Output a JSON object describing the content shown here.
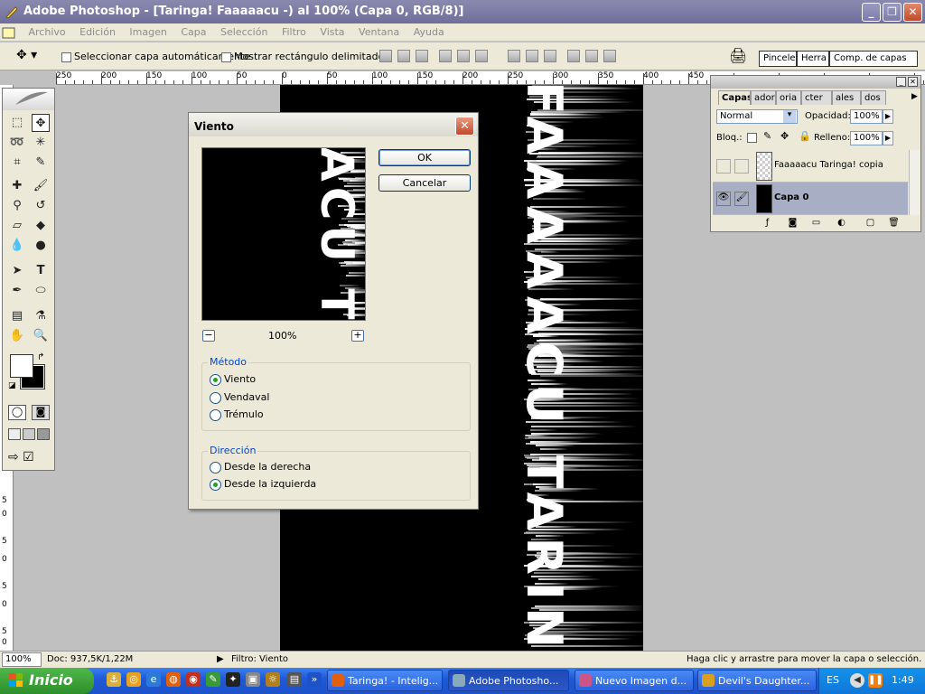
{
  "window": {
    "title": "Adobe Photoshop - [Taringa! Faaaaacu -) al 100% (Capa 0, RGB/8)]",
    "minimize": "_",
    "restore": "❐",
    "close": "✕"
  },
  "menu": [
    "Archivo",
    "Edición",
    "Imagen",
    "Capa",
    "Selección",
    "Filtro",
    "Vista",
    "Ventana",
    "Ayuda"
  ],
  "options": {
    "tool_icon": "move-tool-icon",
    "auto_select": "Seleccionar capa automáticamente",
    "show_bounds": "Mostrar rectángulo delimitador"
  },
  "palette_tabs": [
    "Pincele",
    "Herra",
    "Comp. de capas"
  ],
  "ruler": {
    "h_labels": [
      "250",
      "200",
      "150",
      "100",
      "50",
      "0",
      "50",
      "100",
      "150",
      "200",
      "250",
      "300",
      "350",
      "400",
      "450"
    ],
    "v_labels": [
      "5",
      "0",
      "5",
      "0",
      "5",
      "0",
      "5",
      "0"
    ]
  },
  "canvas": {
    "text": "FAAAAACU TARIN"
  },
  "dialog": {
    "title": "Viento",
    "close": "✕",
    "preview_text": "ACU T",
    "ok": "OK",
    "cancel": "Cancelar",
    "zoom": "100%",
    "zoom_out": "−",
    "zoom_in": "+",
    "method_label": "Método",
    "methods": [
      {
        "label": "Viento",
        "selected": true
      },
      {
        "label": "Vendaval",
        "selected": false
      },
      {
        "label": "Trémulo",
        "selected": false
      }
    ],
    "direction_label": "Dirección",
    "directions": [
      {
        "label": "Desde la derecha",
        "selected": false
      },
      {
        "label": "Desde la izquierda",
        "selected": true
      }
    ]
  },
  "layers_panel": {
    "tabs": [
      "Capas",
      "ador",
      "oria",
      "cter",
      "ales",
      "dos"
    ],
    "blend_mode": "Normal",
    "opacity_label": "Opacidad:",
    "opacity": "100%",
    "lock_label": "Bloq.:",
    "fill_label": "Relleno:",
    "fill": "100%",
    "layers": [
      {
        "name": "Faaaaacu Taringa! copia",
        "visible": false
      },
      {
        "name": "Capa 0",
        "visible": true,
        "selected": true
      }
    ]
  },
  "status": {
    "zoom": "100%",
    "doc": "Doc: 937,5K/1,22M",
    "filter": "Filtro: Viento",
    "hint": "Haga clic y arrastre para mover la capa o selección. Use M"
  },
  "taskbar": {
    "start": "Inicio",
    "tasks": [
      {
        "label": "Taringa! - Intelig..."
      },
      {
        "label": "Adobe Photosho...",
        "active": true
      },
      {
        "label": "Nuevo Imagen d..."
      },
      {
        "label": "Devil's Daughter..."
      }
    ],
    "lang": "ES",
    "clock": "1:49"
  }
}
